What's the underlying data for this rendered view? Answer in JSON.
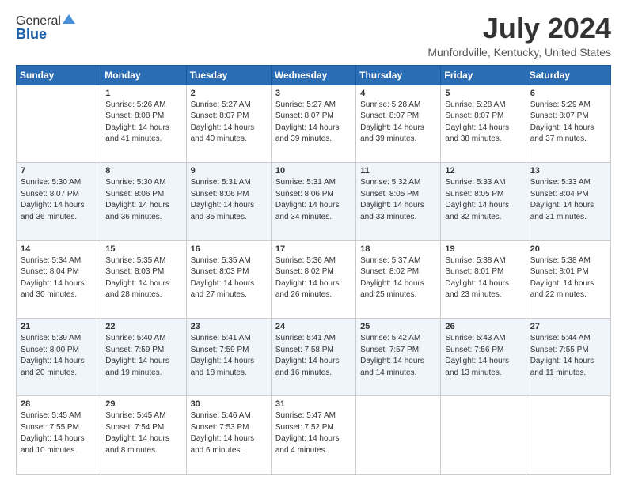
{
  "header": {
    "logo_general": "General",
    "logo_blue": "Blue",
    "month_title": "July 2024",
    "location": "Munfordville, Kentucky, United States"
  },
  "days_of_week": [
    "Sunday",
    "Monday",
    "Tuesday",
    "Wednesday",
    "Thursday",
    "Friday",
    "Saturday"
  ],
  "weeks": [
    [
      {
        "day": "",
        "info": ""
      },
      {
        "day": "1",
        "info": "Sunrise: 5:26 AM\nSunset: 8:08 PM\nDaylight: 14 hours\nand 41 minutes."
      },
      {
        "day": "2",
        "info": "Sunrise: 5:27 AM\nSunset: 8:07 PM\nDaylight: 14 hours\nand 40 minutes."
      },
      {
        "day": "3",
        "info": "Sunrise: 5:27 AM\nSunset: 8:07 PM\nDaylight: 14 hours\nand 39 minutes."
      },
      {
        "day": "4",
        "info": "Sunrise: 5:28 AM\nSunset: 8:07 PM\nDaylight: 14 hours\nand 39 minutes."
      },
      {
        "day": "5",
        "info": "Sunrise: 5:28 AM\nSunset: 8:07 PM\nDaylight: 14 hours\nand 38 minutes."
      },
      {
        "day": "6",
        "info": "Sunrise: 5:29 AM\nSunset: 8:07 PM\nDaylight: 14 hours\nand 37 minutes."
      }
    ],
    [
      {
        "day": "7",
        "info": "Sunrise: 5:30 AM\nSunset: 8:07 PM\nDaylight: 14 hours\nand 36 minutes."
      },
      {
        "day": "8",
        "info": "Sunrise: 5:30 AM\nSunset: 8:06 PM\nDaylight: 14 hours\nand 36 minutes."
      },
      {
        "day": "9",
        "info": "Sunrise: 5:31 AM\nSunset: 8:06 PM\nDaylight: 14 hours\nand 35 minutes."
      },
      {
        "day": "10",
        "info": "Sunrise: 5:31 AM\nSunset: 8:06 PM\nDaylight: 14 hours\nand 34 minutes."
      },
      {
        "day": "11",
        "info": "Sunrise: 5:32 AM\nSunset: 8:05 PM\nDaylight: 14 hours\nand 33 minutes."
      },
      {
        "day": "12",
        "info": "Sunrise: 5:33 AM\nSunset: 8:05 PM\nDaylight: 14 hours\nand 32 minutes."
      },
      {
        "day": "13",
        "info": "Sunrise: 5:33 AM\nSunset: 8:04 PM\nDaylight: 14 hours\nand 31 minutes."
      }
    ],
    [
      {
        "day": "14",
        "info": "Sunrise: 5:34 AM\nSunset: 8:04 PM\nDaylight: 14 hours\nand 30 minutes."
      },
      {
        "day": "15",
        "info": "Sunrise: 5:35 AM\nSunset: 8:03 PM\nDaylight: 14 hours\nand 28 minutes."
      },
      {
        "day": "16",
        "info": "Sunrise: 5:35 AM\nSunset: 8:03 PM\nDaylight: 14 hours\nand 27 minutes."
      },
      {
        "day": "17",
        "info": "Sunrise: 5:36 AM\nSunset: 8:02 PM\nDaylight: 14 hours\nand 26 minutes."
      },
      {
        "day": "18",
        "info": "Sunrise: 5:37 AM\nSunset: 8:02 PM\nDaylight: 14 hours\nand 25 minutes."
      },
      {
        "day": "19",
        "info": "Sunrise: 5:38 AM\nSunset: 8:01 PM\nDaylight: 14 hours\nand 23 minutes."
      },
      {
        "day": "20",
        "info": "Sunrise: 5:38 AM\nSunset: 8:01 PM\nDaylight: 14 hours\nand 22 minutes."
      }
    ],
    [
      {
        "day": "21",
        "info": "Sunrise: 5:39 AM\nSunset: 8:00 PM\nDaylight: 14 hours\nand 20 minutes."
      },
      {
        "day": "22",
        "info": "Sunrise: 5:40 AM\nSunset: 7:59 PM\nDaylight: 14 hours\nand 19 minutes."
      },
      {
        "day": "23",
        "info": "Sunrise: 5:41 AM\nSunset: 7:59 PM\nDaylight: 14 hours\nand 18 minutes."
      },
      {
        "day": "24",
        "info": "Sunrise: 5:41 AM\nSunset: 7:58 PM\nDaylight: 14 hours\nand 16 minutes."
      },
      {
        "day": "25",
        "info": "Sunrise: 5:42 AM\nSunset: 7:57 PM\nDaylight: 14 hours\nand 14 minutes."
      },
      {
        "day": "26",
        "info": "Sunrise: 5:43 AM\nSunset: 7:56 PM\nDaylight: 14 hours\nand 13 minutes."
      },
      {
        "day": "27",
        "info": "Sunrise: 5:44 AM\nSunset: 7:55 PM\nDaylight: 14 hours\nand 11 minutes."
      }
    ],
    [
      {
        "day": "28",
        "info": "Sunrise: 5:45 AM\nSunset: 7:55 PM\nDaylight: 14 hours\nand 10 minutes."
      },
      {
        "day": "29",
        "info": "Sunrise: 5:45 AM\nSunset: 7:54 PM\nDaylight: 14 hours\nand 8 minutes."
      },
      {
        "day": "30",
        "info": "Sunrise: 5:46 AM\nSunset: 7:53 PM\nDaylight: 14 hours\nand 6 minutes."
      },
      {
        "day": "31",
        "info": "Sunrise: 5:47 AM\nSunset: 7:52 PM\nDaylight: 14 hours\nand 4 minutes."
      },
      {
        "day": "",
        "info": ""
      },
      {
        "day": "",
        "info": ""
      },
      {
        "day": "",
        "info": ""
      }
    ]
  ]
}
